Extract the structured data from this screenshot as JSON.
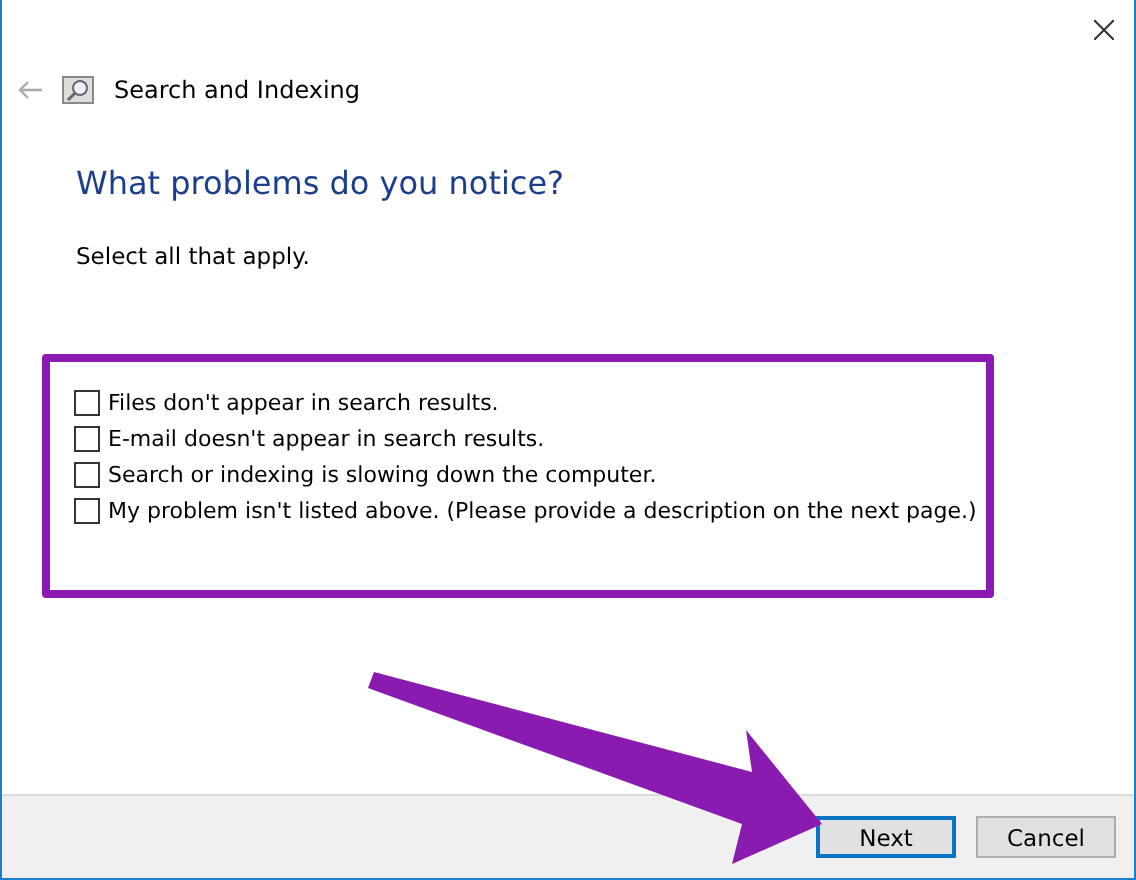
{
  "window": {
    "title": "Search and Indexing"
  },
  "heading": "What problems do you notice?",
  "instruction": "Select all that apply.",
  "options": [
    {
      "label": "Files don't appear in search results.",
      "checked": false
    },
    {
      "label": "E-mail doesn't appear in search results.",
      "checked": false
    },
    {
      "label": "Search or indexing is slowing down the computer.",
      "checked": false
    },
    {
      "label": "My problem isn't listed above. (Please provide a description on the next page.)",
      "checked": false
    }
  ],
  "buttons": [
    {
      "label": "Next",
      "selected": true
    },
    {
      "label": "Cancel",
      "selected": false
    }
  ]
}
